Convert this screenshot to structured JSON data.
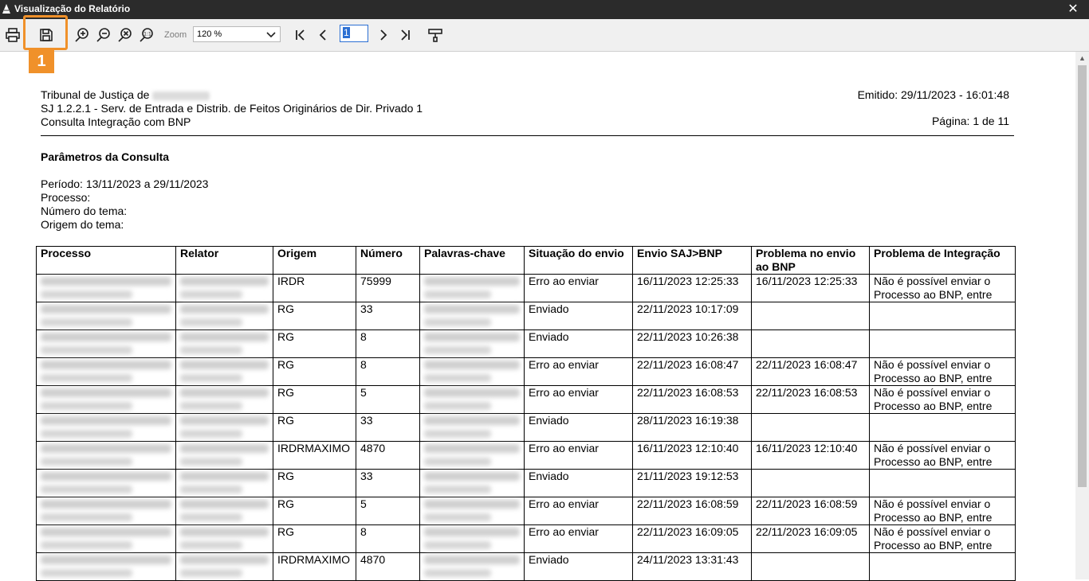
{
  "window": {
    "title": "Visualização do Relatório",
    "close_glyph": "✕"
  },
  "toolbar": {
    "buttons": [
      "print-icon",
      "save-icon",
      "zoom-in-icon",
      "zoom-out-icon",
      "zoom-reset-icon",
      "zoom-actual-icon"
    ],
    "zoom_label": "Zoom",
    "zoom_value": "120 %",
    "page_value": "1",
    "highlight_number": "1"
  },
  "report": {
    "header_left": [
      "Tribunal de Justiça de",
      "SJ 1.2.2.1 - Serv. de Entrada e Distrib. de Feitos Originários de Dir. Privado 1",
      "Consulta Integração com BNP"
    ],
    "emitted": "Emitido: 29/11/2023 - 16:01:48",
    "page": "Página: 1 de 11",
    "params_title": "Parâmetros da Consulta",
    "params": [
      "Período:  13/11/2023 a 29/11/2023",
      "Processo:",
      "Número do tema:",
      "Origem do tema:"
    ],
    "columns": [
      "Processo",
      "Relator",
      "Origem",
      "Número",
      "Palavras-chave",
      "Situação do envio",
      "Envio SAJ>BNP",
      "Problema no envio ao BNP",
      "Problema de Integração"
    ],
    "rows": [
      {
        "origem": "IRDR",
        "numero": "75999",
        "situacao": "Erro ao enviar",
        "envio": "16/11/2023 12:25:33",
        "problema_envio": "16/11/2023 12:25:33",
        "problema_integracao": "Não é possível enviar o Processo ao BNP, entre"
      },
      {
        "origem": "RG",
        "numero": "33",
        "situacao": "Enviado",
        "envio": "22/11/2023 10:17:09",
        "problema_envio": "",
        "problema_integracao": ""
      },
      {
        "origem": "RG",
        "numero": "8",
        "situacao": "Enviado",
        "envio": "22/11/2023 10:26:38",
        "problema_envio": "",
        "problema_integracao": ""
      },
      {
        "origem": "RG",
        "numero": "8",
        "situacao": "Erro ao enviar",
        "envio": "22/11/2023 16:08:47",
        "problema_envio": "22/11/2023 16:08:47",
        "problema_integracao": "Não é possível enviar o Processo ao BNP, entre"
      },
      {
        "origem": "RG",
        "numero": "5",
        "situacao": "Erro ao enviar",
        "envio": "22/11/2023 16:08:53",
        "problema_envio": "22/11/2023 16:08:53",
        "problema_integracao": "Não é possível enviar o Processo ao BNP, entre"
      },
      {
        "origem": "RG",
        "numero": "33",
        "situacao": "Enviado",
        "envio": "28/11/2023 16:19:38",
        "problema_envio": "",
        "problema_integracao": ""
      },
      {
        "origem": "IRDRMAXIMO",
        "numero": "4870",
        "situacao": "Erro ao enviar",
        "envio": "16/11/2023 12:10:40",
        "problema_envio": "16/11/2023 12:10:40",
        "problema_integracao": "Não é possível enviar o Processo ao BNP, entre"
      },
      {
        "origem": "RG",
        "numero": "33",
        "situacao": "Enviado",
        "envio": "21/11/2023 19:12:53",
        "problema_envio": "",
        "problema_integracao": ""
      },
      {
        "origem": "RG",
        "numero": "5",
        "situacao": "Erro ao enviar",
        "envio": "22/11/2023 16:08:59",
        "problema_envio": "22/11/2023 16:08:59",
        "problema_integracao": "Não é possível enviar o Processo ao BNP, entre"
      },
      {
        "origem": "RG",
        "numero": "8",
        "situacao": "Erro ao enviar",
        "envio": "22/11/2023 16:09:05",
        "problema_envio": "22/11/2023 16:09:05",
        "problema_integracao": "Não é possível enviar o Processo ao BNP, entre"
      },
      {
        "origem": "IRDRMAXIMO",
        "numero": "4870",
        "situacao": "Enviado",
        "envio": "24/11/2023 13:31:43",
        "problema_envio": "",
        "problema_integracao": ""
      }
    ]
  }
}
